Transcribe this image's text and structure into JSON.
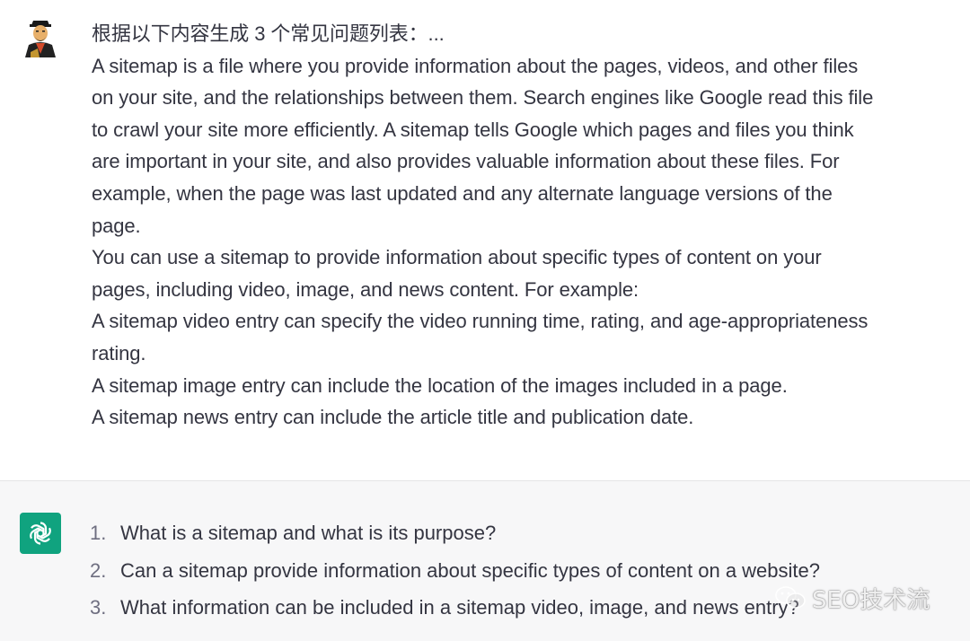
{
  "user_message": {
    "lines": [
      "根据以下内容生成 3 个常见问题列表：...",
      "A sitemap is a file where you provide information about the pages, videos, and other files",
      "on your site, and the relationships between them. Search engines like Google read this file",
      "to crawl your site more efficiently. A sitemap tells Google which pages and files you think",
      "are important in your site, and also provides valuable information about these files. For",
      "example, when the page was last updated and any alternate language versions of the",
      "page.",
      "You can use a sitemap to provide information about specific types of content on your",
      "pages, including video, image, and news content. For example:",
      "A sitemap video entry can specify the video running time, rating, and age-appropriateness",
      "rating.",
      "A sitemap image entry can include the location of the images included in a page.",
      "A sitemap news entry can include the article title and publication date."
    ],
    "avatar_icon": "user-portrait-avatar"
  },
  "assistant_message": {
    "avatar_icon": "chatgpt-logo-icon",
    "avatar_color": "#10a37f",
    "items": [
      {
        "num": "1.",
        "text": "What is a sitemap and what is its purpose?"
      },
      {
        "num": "2.",
        "text": "Can a sitemap provide information about specific types of content on a website?"
      },
      {
        "num": "3.",
        "text": "What information can be included in a sitemap video, image, and news entry?"
      }
    ]
  },
  "watermark": {
    "icon": "wechat-icon",
    "text": "SEO技术流"
  },
  "colors": {
    "text": "#343541",
    "assistant_bg": "#f7f7f8",
    "user_bg": "#ffffff",
    "number": "#6e6e80"
  }
}
